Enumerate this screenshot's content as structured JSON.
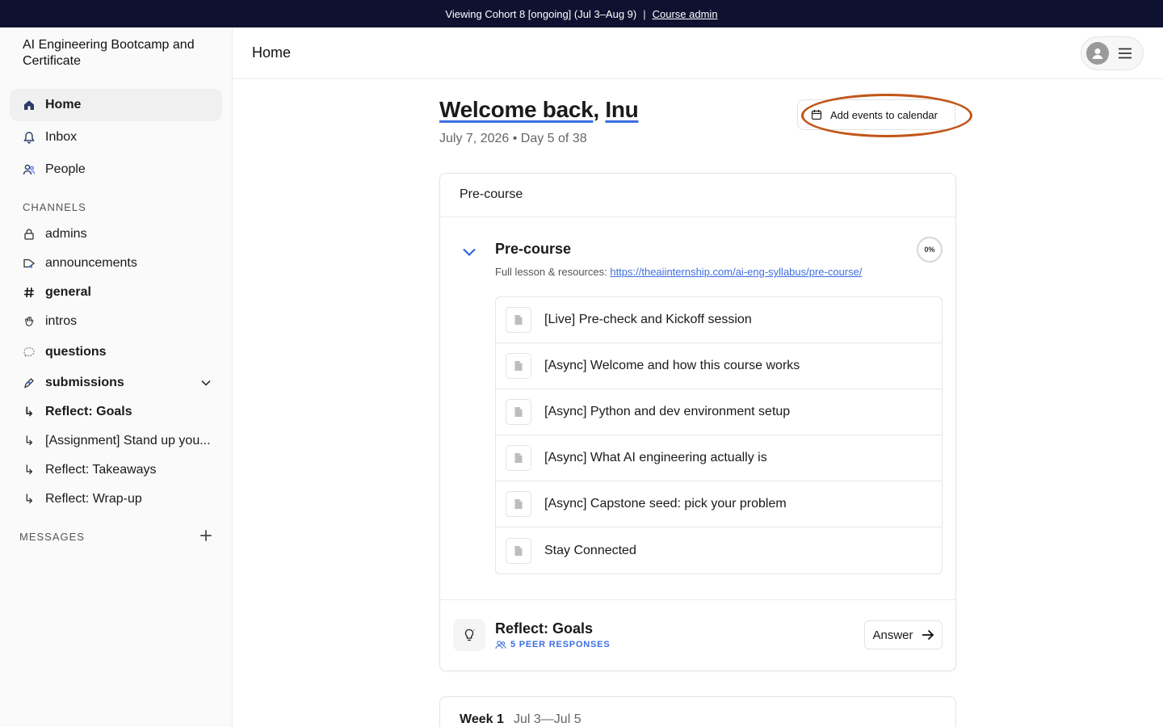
{
  "banner": {
    "text": "Viewing Cohort 8 [ongoing] (Jul 3–Aug 9)",
    "separator": "|",
    "link": "Course admin"
  },
  "sidebar": {
    "brand": "AI Engineering Bootcamp and Certificate",
    "nav": [
      {
        "label": "Home",
        "icon": "home-icon",
        "active": true
      },
      {
        "label": "Inbox",
        "icon": "bell-icon"
      },
      {
        "label": "People",
        "icon": "people-icon"
      }
    ],
    "channels_label": "CHANNELS",
    "channels": [
      {
        "label": "admins",
        "icon": "lock-icon"
      },
      {
        "label": "announcements",
        "icon": "megaphone-icon"
      },
      {
        "label": "general",
        "icon": "hash-icon"
      },
      {
        "label": "intros",
        "icon": "wave-icon"
      },
      {
        "label": "questions",
        "icon": "chat-bubble-icon"
      },
      {
        "label": "submissions",
        "icon": "pen-icon"
      }
    ],
    "sub_items": [
      "Reflect: Goals",
      "[Assignment] Stand up you...",
      "Reflect: Takeaways",
      "Reflect: Wrap-up"
    ],
    "sub_arrow": "↳",
    "messages_label": "MESSAGES"
  },
  "header": {
    "title": "Home"
  },
  "main": {
    "welcome_prefix": "Welcome back",
    "welcome_comma": ", ",
    "welcome_name": "Inu",
    "date_line": "July 7, 2026 • Day 5 of 38",
    "calendar_button": "Add events to calendar",
    "card": {
      "header": "Pre-course",
      "section_title": "Pre-course",
      "progress": "0%",
      "resources_label": "Full lesson & resources: ",
      "resources_link": "https://theaiinternship.com/ai-eng-syllabus/pre-course/",
      "lessons": [
        "[Live] Pre-check and Kickoff session",
        "[Async] Welcome and how this course works",
        "[Async] Python and dev environment setup",
        "[Async] What AI engineering actually is",
        "[Async] Capstone seed: pick your problem",
        "Stay Connected"
      ],
      "reflect_title": "Reflect: Goals",
      "peer_responses": "5 PEER RESPONSES",
      "answer_button": "Answer"
    },
    "week": {
      "title": "Week 1",
      "range": "Jul 3—Jul 5"
    }
  },
  "colors": {
    "banner_bg": "#0f1130",
    "accent_blue": "#3d6fe0",
    "highlight_ring": "#c25619"
  }
}
